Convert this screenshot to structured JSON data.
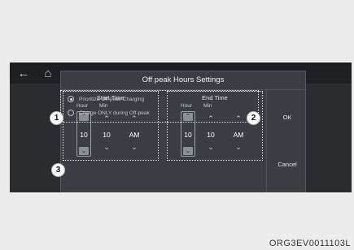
{
  "topbar": {
    "back_icon": "back-arrow-icon",
    "home_icon": "home-icon"
  },
  "dialog": {
    "title": "Off peak Hours Settings",
    "start": {
      "title": "Start Time",
      "hour_label": "Hour",
      "min_label": "Min",
      "hour": "10",
      "min": "10",
      "ampm": "AM"
    },
    "end": {
      "title": "End Time",
      "hour_label": "Hour",
      "min_label": "Min",
      "hour": "10",
      "min": "10",
      "ampm": "AM"
    },
    "options": [
      {
        "label": "Prioritize Off-peak Charging",
        "selected": true
      },
      {
        "label": "Charge ONLY during Off-peak",
        "selected": false
      }
    ],
    "ok_label": "OK",
    "cancel_label": "Cancel"
  },
  "callouts": [
    "1",
    "2",
    "3"
  ],
  "caption": "ORG3EV0011103L"
}
